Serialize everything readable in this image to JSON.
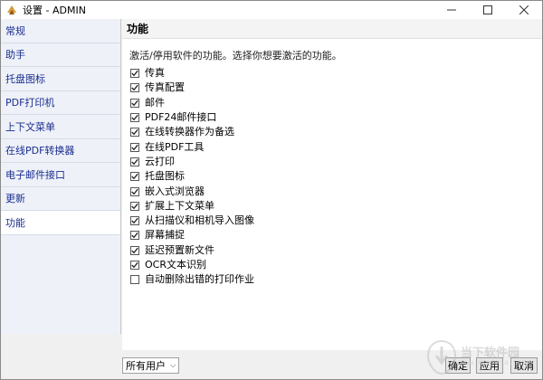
{
  "window": {
    "title": "设置 - ADMIN",
    "controls": [
      "minimize-icon",
      "maximize-icon",
      "close-icon"
    ]
  },
  "sidebar": {
    "items": [
      {
        "label": "常规"
      },
      {
        "label": "助手"
      },
      {
        "label": "托盘图标"
      },
      {
        "label": "PDF打印机"
      },
      {
        "label": "上下文菜单"
      },
      {
        "label": "在线PDF转换器"
      },
      {
        "label": "电子邮件接口"
      },
      {
        "label": "更新"
      },
      {
        "label": "功能"
      }
    ],
    "active_index": 8
  },
  "main": {
    "title": "功能",
    "description": "激活/停用软件的功能。选择你想要激活的功能。",
    "features": [
      {
        "label": "传真",
        "checked": true
      },
      {
        "label": "传真配置",
        "checked": true
      },
      {
        "label": "邮件",
        "checked": true
      },
      {
        "label": "PDF24邮件接口",
        "checked": true
      },
      {
        "label": "在线转换器作为备选",
        "checked": true
      },
      {
        "label": "在线PDF工具",
        "checked": true
      },
      {
        "label": "云打印",
        "checked": true
      },
      {
        "label": "托盘图标",
        "checked": true
      },
      {
        "label": "嵌入式浏览器",
        "checked": true
      },
      {
        "label": "扩展上下文菜单",
        "checked": true
      },
      {
        "label": "从扫描仪和相机导入图像",
        "checked": true
      },
      {
        "label": "屏幕捕捉",
        "checked": true
      },
      {
        "label": "延迟预置新文件",
        "checked": true
      },
      {
        "label": "OCR文本识别",
        "checked": true
      },
      {
        "label": "自动删除出错的打印作业",
        "checked": false
      }
    ]
  },
  "footer": {
    "user_select": "所有用户",
    "ok_label": "确定",
    "apply_label": "应用",
    "cancel_label": "取消"
  },
  "watermark": {
    "text": "当下软件园",
    "sub": "www.downxia.com"
  }
}
